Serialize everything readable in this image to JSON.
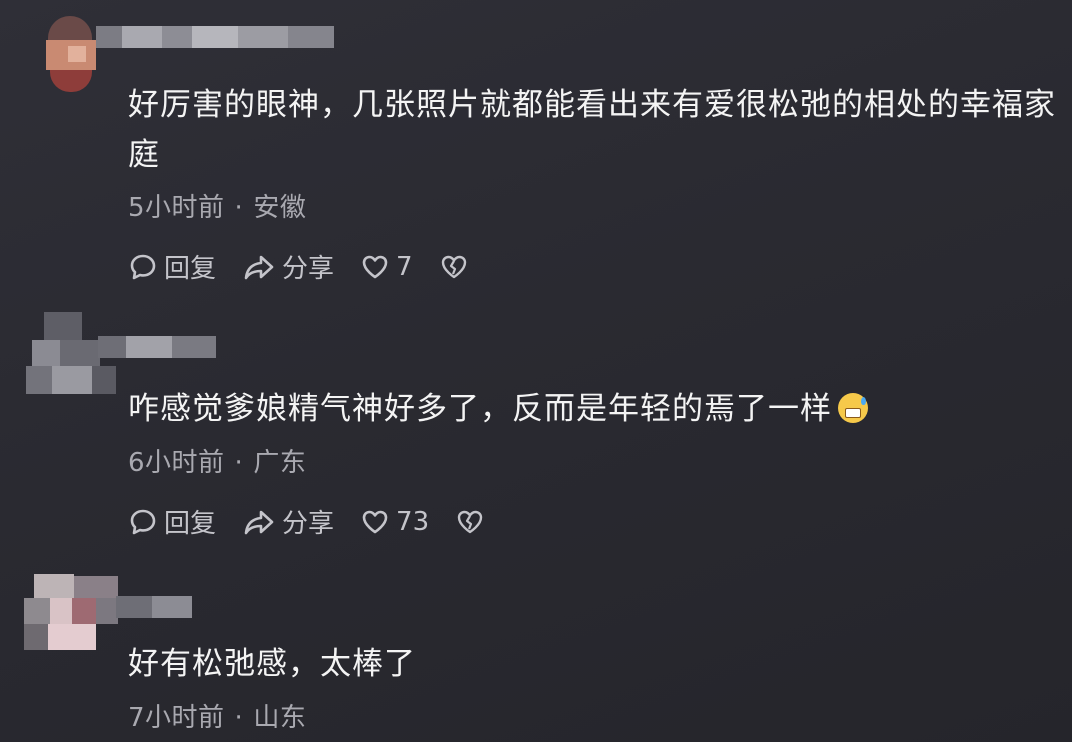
{
  "comments": [
    {
      "text": "好厉害的眼神，几张照片就都能看出来有爱很松弛的相处的幸福家庭",
      "time": "5小时前",
      "location": "安徽",
      "reply_label": "回复",
      "share_label": "分享",
      "likes": "7"
    },
    {
      "text": "咋感觉爹娘精气神好多了，反而是年轻的焉了一样",
      "emoji": "grimacing-sweat-emoji",
      "time": "6小时前",
      "location": "广东",
      "reply_label": "回复",
      "share_label": "分享",
      "likes": "73"
    },
    {
      "text": "好有松弛感，太棒了",
      "time": "7小时前",
      "location": "山东"
    }
  ],
  "meta_separator": "·",
  "icons": {
    "reply": "speech-bubble-icon",
    "share": "share-arrow-icon",
    "like": "heart-icon",
    "dislike": "broken-heart-icon"
  },
  "colors": {
    "background": "#2b2b32",
    "text": "#f4f4f4",
    "meta": "#a9a9b0"
  }
}
